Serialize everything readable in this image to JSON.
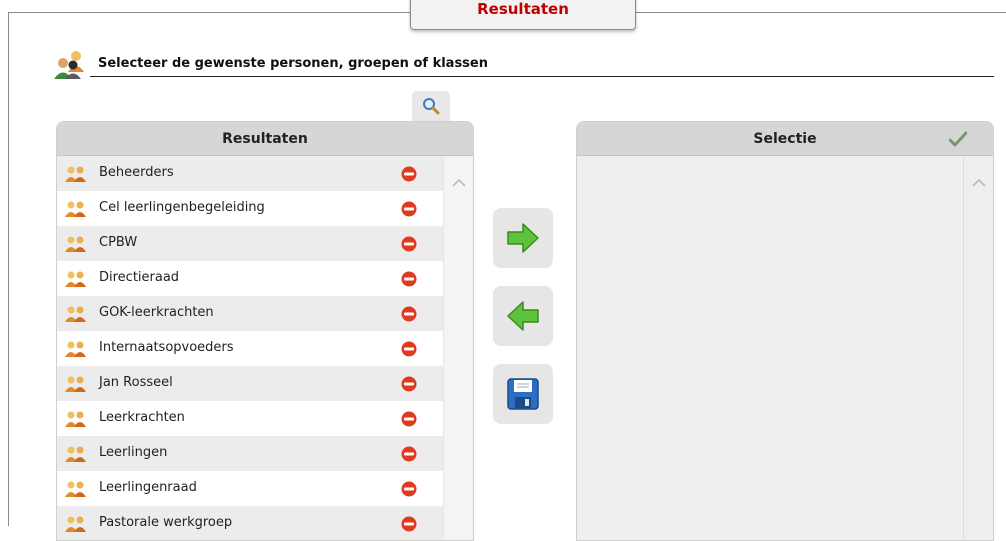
{
  "top_tab": {
    "label": "Resultaten"
  },
  "header": {
    "title": "Selecteer de gewenste personen, groepen of klassen"
  },
  "results_panel": {
    "title": "Resultaten",
    "items": [
      {
        "label": "Beheerders"
      },
      {
        "label": "Cel leerlingenbegeleiding"
      },
      {
        "label": "CPBW"
      },
      {
        "label": "Directieraad"
      },
      {
        "label": "GOK-leerkrachten"
      },
      {
        "label": "Internaatsopvoeders"
      },
      {
        "label": "Jan Rosseel"
      },
      {
        "label": "Leerkrachten"
      },
      {
        "label": "Leerlingen"
      },
      {
        "label": "Leerlingenraad"
      },
      {
        "label": "Pastorale werkgroep"
      }
    ]
  },
  "selection_panel": {
    "title": "Selectie",
    "items": []
  },
  "icons": {
    "header": "people-group-icon",
    "search": "search-icon",
    "group": "group-icon",
    "remove": "remove-icon",
    "confirm": "checkmark-icon",
    "add": "arrow-right-icon",
    "back": "arrow-left-icon",
    "save": "save-icon"
  },
  "colors": {
    "tab_text": "#c00000",
    "remove": "#e03a1e",
    "arrow": "#4caf2a",
    "save": "#2a6fc4"
  }
}
